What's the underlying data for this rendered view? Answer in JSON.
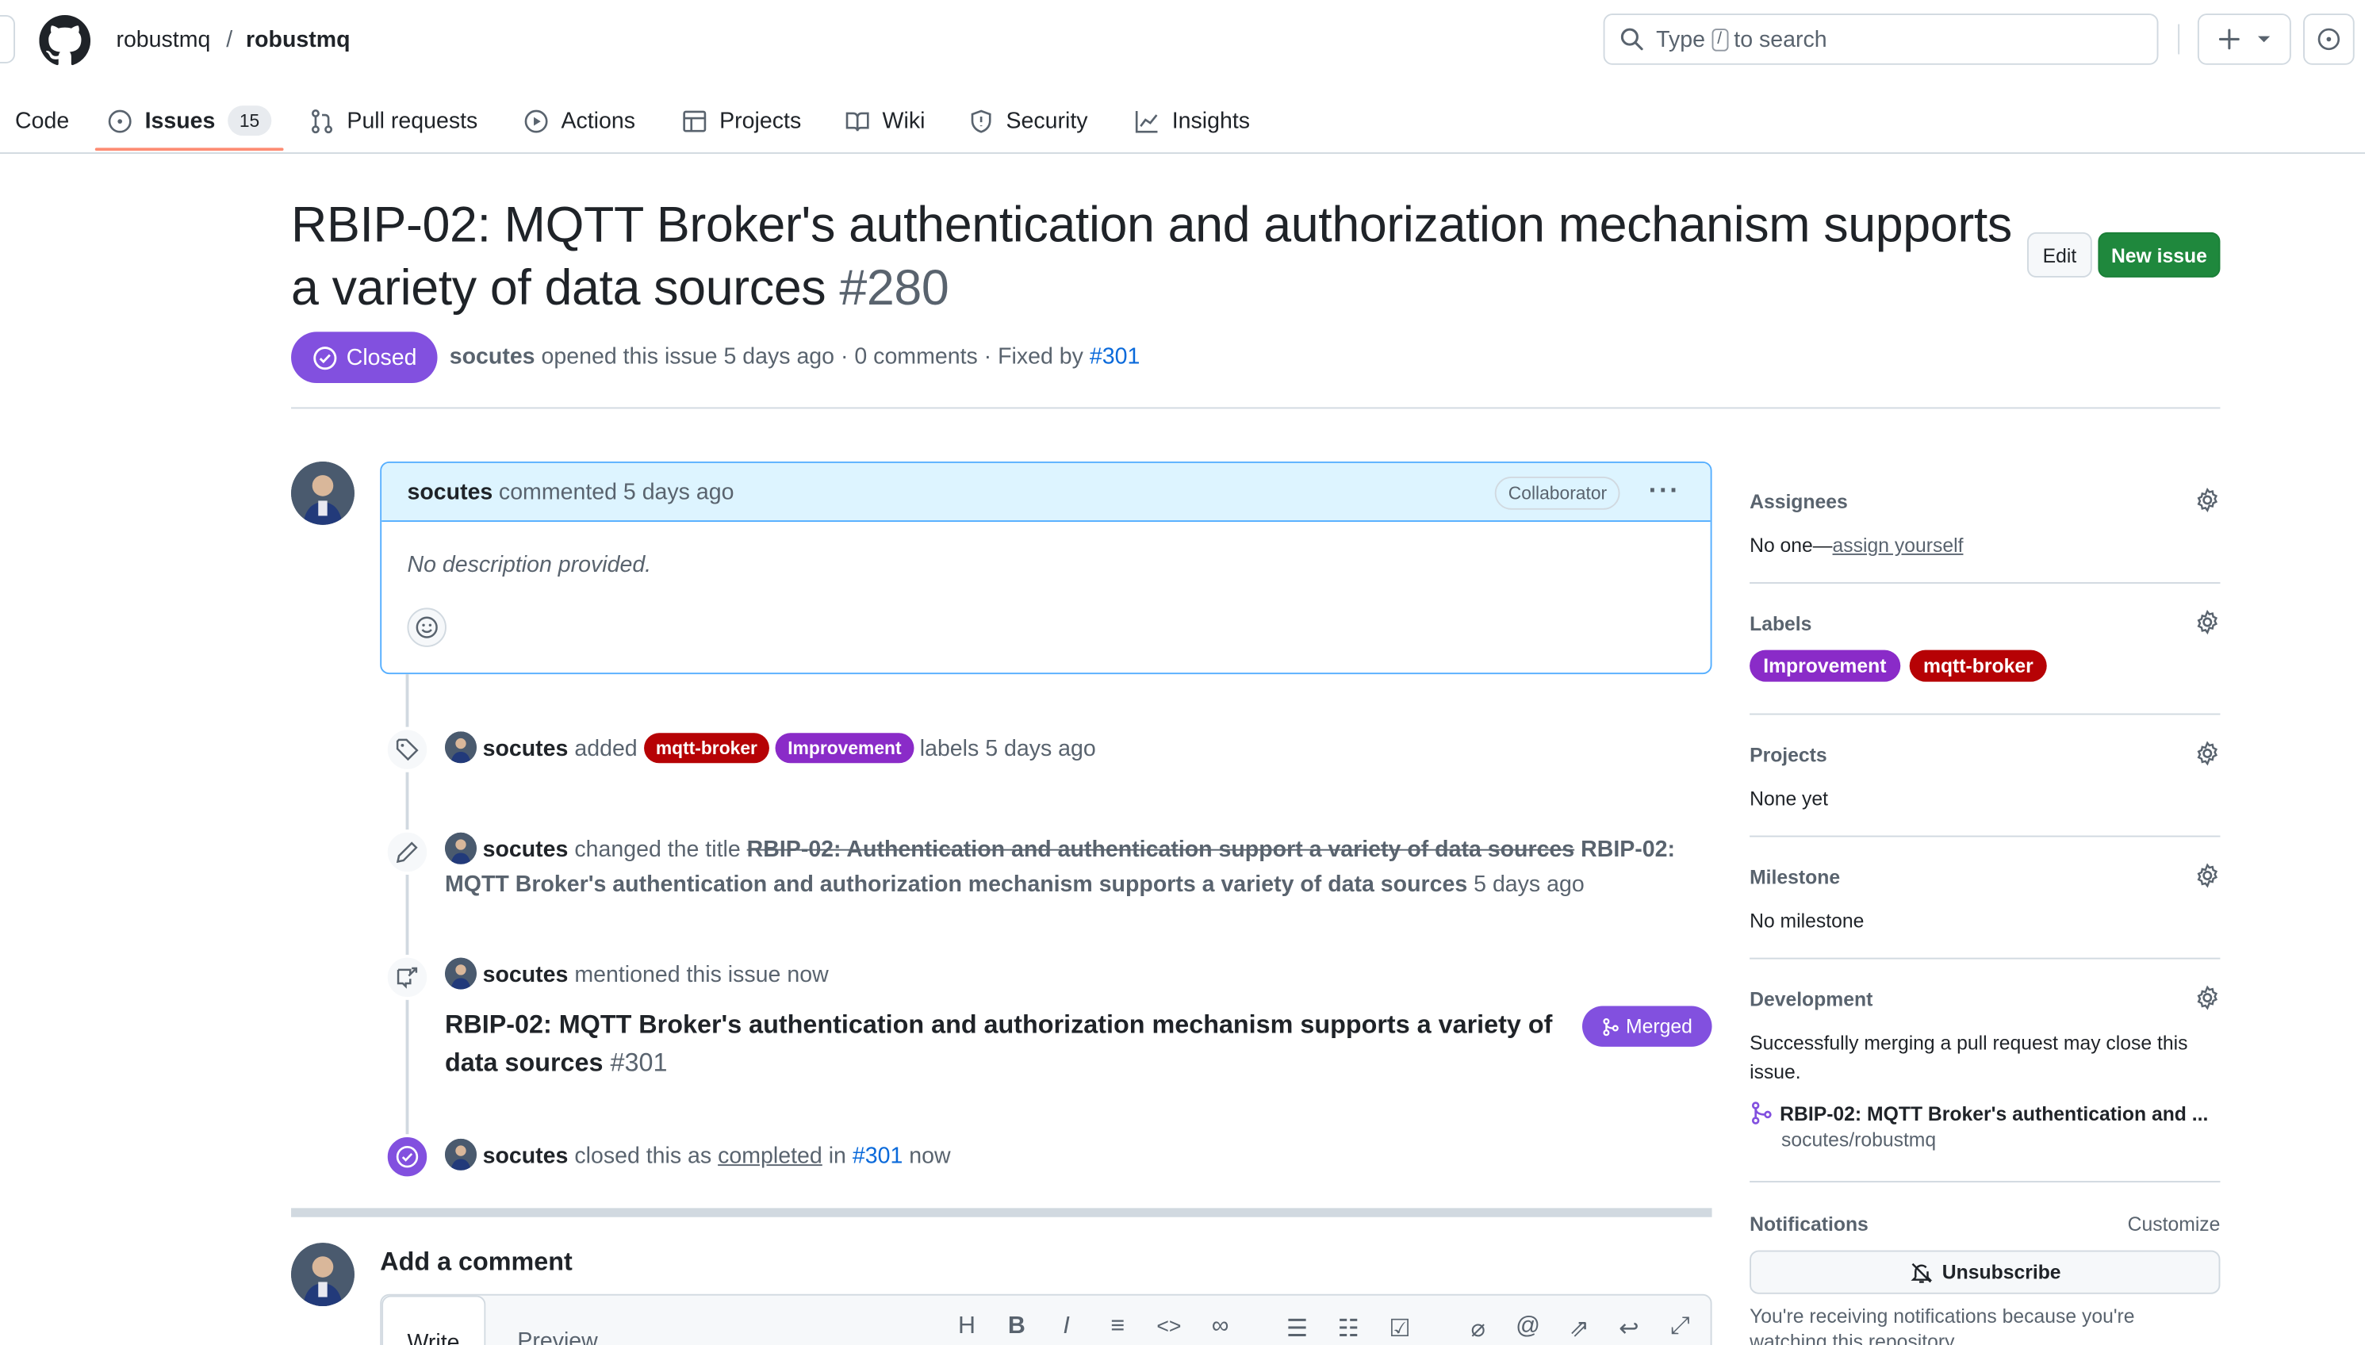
{
  "header": {
    "owner": "robustmq",
    "slash": "/",
    "repo": "robustmq",
    "search_prefix": "Type",
    "search_key": "/",
    "search_suffix": "to search"
  },
  "tabs": [
    {
      "label": "Code",
      "icon": "code-icon"
    },
    {
      "label": "Issues",
      "icon": "issue-opened-icon",
      "count": "15",
      "active": true
    },
    {
      "label": "Pull requests",
      "icon": "git-pull-request-icon"
    },
    {
      "label": "Actions",
      "icon": "play-icon"
    },
    {
      "label": "Projects",
      "icon": "table-icon"
    },
    {
      "label": "Wiki",
      "icon": "book-icon"
    },
    {
      "label": "Security",
      "icon": "shield-icon"
    },
    {
      "label": "Insights",
      "icon": "graph-icon"
    }
  ],
  "issue": {
    "title": "RBIP-02: MQTT Broker's authentication and authorization mechanism supports a variety of data sources",
    "number": "#280",
    "edit_label": "Edit",
    "new_issue_label": "New issue",
    "status": "Closed",
    "author": "socutes",
    "meta_text": "opened this issue 5 days ago · 0 comments · Fixed by",
    "fixed_by": "#301"
  },
  "comment": {
    "author": "socutes",
    "action": "commented 5 days ago",
    "role": "Collaborator",
    "body": "No description provided."
  },
  "events": {
    "labels": {
      "author": "socutes",
      "verb": "added",
      "label1": "mqtt-broker",
      "label2": "Improvement",
      "suffix": "labels 5 days ago"
    },
    "rename": {
      "author": "socutes",
      "verb": "changed the title",
      "old_title": "RBIP-02: Authentication and authentication support a variety of data sources",
      "new_title": "RBIP-02: MQTT Broker's authentication and authorization mechanism supports a variety of data sources",
      "suffix": "5 days ago"
    },
    "mention": {
      "author": "socutes",
      "verb": "mentioned this issue now",
      "ref_title": "RBIP-02: MQTT Broker's authentication and authorization mechanism supports a variety of data sources",
      "ref_number": "#301",
      "ref_state": "Merged"
    },
    "closed": {
      "author": "socutes",
      "verb": "closed this as",
      "reason": "completed",
      "in": "in",
      "pr": "#301",
      "suffix": "now"
    }
  },
  "composer": {
    "heading": "Add a comment",
    "write_tab": "Write",
    "preview_tab": "Preview"
  },
  "sidebar": {
    "assignees": {
      "title": "Assignees",
      "value": "No one—",
      "link": "assign yourself"
    },
    "labels": {
      "title": "Labels",
      "items": [
        "Improvement",
        "mqtt-broker"
      ]
    },
    "projects": {
      "title": "Projects",
      "value": "None yet"
    },
    "milestone": {
      "title": "Milestone",
      "value": "No milestone"
    },
    "development": {
      "title": "Development",
      "note": "Successfully merging a pull request may close this issue.",
      "pr_title": "RBIP-02: MQTT Broker's authentication and ...",
      "pr_repo": "socutes/robustmq"
    },
    "notifications": {
      "title": "Notifications",
      "customize": "Customize",
      "unsubscribe": "Unsubscribe",
      "note": "You're receiving notifications because you're watching this repository."
    }
  },
  "colors": {
    "closed_purple": "#8250df",
    "primary_green": "#1f883d",
    "label_mqtt": "#b60205",
    "label_improvement": "#8a2bc8",
    "link_blue": "#0969da",
    "active_tab_underline": "#fd8c73"
  }
}
